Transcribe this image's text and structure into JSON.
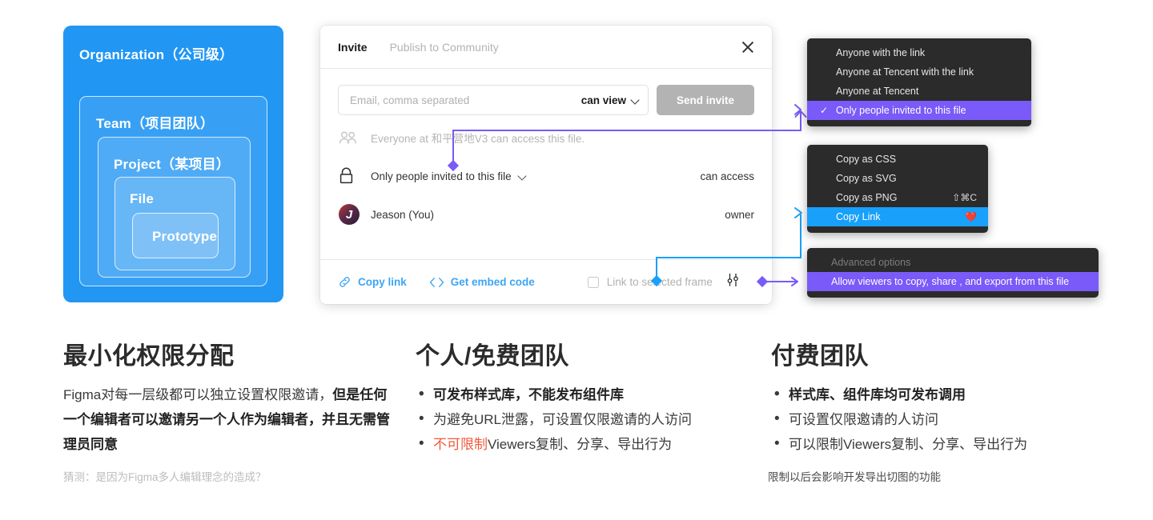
{
  "hierarchy": {
    "organization": "Organization（公司级）",
    "team": "Team（项目团队）",
    "project": "Project（某项目）",
    "file": "File",
    "prototype": "Prototype",
    "color": "#2196F3"
  },
  "dialog": {
    "tab_invite": "Invite",
    "tab_publish": "Publish to Community",
    "email_placeholder": "Email, comma separated",
    "email_value": "",
    "permission_selected": "can view",
    "send_button": "Send invite",
    "rows": [
      {
        "icon": "people-icon",
        "label": "Everyone at 和平营地V3 can access this file.",
        "right": ""
      },
      {
        "icon": "lock-icon",
        "label": "Only people invited to this file",
        "right": "can access"
      },
      {
        "icon": "avatar",
        "label": "Jeason (You)",
        "right": "owner",
        "avatar_initial": "J"
      }
    ],
    "footer": {
      "copy_link": "Copy link",
      "get_embed_code": "Get embed code",
      "link_to_selected_frame": "Link to selected frame",
      "checkbox_checked": false
    }
  },
  "menus": {
    "visibility": {
      "items": [
        {
          "label": "Anyone with the link",
          "checked": false,
          "highlight": "none"
        },
        {
          "label": "Anyone at Tencent with the link",
          "checked": false,
          "highlight": "none"
        },
        {
          "label": "Anyone at Tencent",
          "checked": false,
          "highlight": "none"
        },
        {
          "label": "Only people invited to this file",
          "checked": true,
          "highlight": "purple"
        }
      ],
      "highlight_color": "#7a5af8"
    },
    "copy": {
      "items": [
        {
          "label": "Copy as CSS",
          "shortcut": "",
          "highlight": "none"
        },
        {
          "label": "Copy as SVG",
          "shortcut": "",
          "highlight": "none"
        },
        {
          "label": "Copy as PNG",
          "shortcut": "⇧⌘C",
          "highlight": "none"
        },
        {
          "label": "Copy Link",
          "shortcut": "",
          "heart": "❤️",
          "highlight": "blue"
        }
      ],
      "highlight_color": "#18A0FB"
    },
    "advanced": {
      "items": [
        {
          "label": "Advanced options",
          "highlight": "none",
          "dim": true
        },
        {
          "label": "Allow viewers to copy, share , and export from this file",
          "highlight": "purple"
        }
      ],
      "highlight_color": "#7a5af8"
    }
  },
  "columns": [
    {
      "heading": "最小化权限分配",
      "paragraph_plain": "Figma对每一层级都可以独立设置权限邀请，",
      "paragraph_bold": "但是任何一个编辑者可以邀请另一个人作为编辑者，并且无需管理员同意",
      "note": "猜测：是因为Figma多人编辑理念的造成？"
    },
    {
      "heading": "个人/免费团队",
      "bullets": [
        {
          "text": "可发布样式库，不能发布组件库",
          "bold": true
        },
        {
          "text": "为避免URL泄露，可设置仅限邀请的人访问",
          "bold": false
        },
        {
          "text_red": "不可限制",
          "text": "Viewers复制、分享、导出行为",
          "bold": false
        }
      ],
      "note": ""
    },
    {
      "heading": "付费团队",
      "bullets": [
        {
          "text": "样式库、组件库均可发布调用",
          "bold": true
        },
        {
          "text": "可设置仅限邀请的人访问",
          "bold": false
        },
        {
          "text": "可以限制Viewers复制、分享、导出行为",
          "bold": false
        }
      ],
      "note": "限制以后会影响开发导出切图的功能"
    }
  ],
  "connectors": {
    "purple_color": "#7a5af8",
    "blue_color": "#18A0FB"
  }
}
